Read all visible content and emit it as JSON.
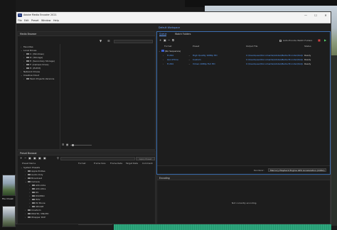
{
  "window": {
    "title": "Adobe Media Encoder 2021",
    "minimize": "—",
    "maximize": "☐",
    "close": "✕"
  },
  "menu": [
    "File",
    "Edit",
    "Preset",
    "Window",
    "Help"
  ],
  "media_browser": {
    "title": "Media Browser",
    "items": [
      {
        "label": "Favorites",
        "indent": 0,
        "arrow": "›"
      },
      {
        "label": "Local Drives",
        "indent": 0,
        "arrow": "⌄"
      },
      {
        "label": "C: (Windows)",
        "indent": 1,
        "arrow": "›"
      },
      {
        "label": "D: (Storage)",
        "indent": 1,
        "arrow": "›"
      },
      {
        "label": "E: (Secondary Storage)",
        "indent": 1,
        "arrow": "›"
      },
      {
        "label": "F: (Camera Drive)",
        "indent": 1,
        "arrow": "›"
      },
      {
        "label": "H: (ExFAT)",
        "indent": 1,
        "arrow": "›"
      },
      {
        "label": "Network Drives",
        "indent": 0,
        "arrow": "›"
      },
      {
        "label": "Creative Cloud",
        "indent": 0,
        "arrow": "⌄"
      },
      {
        "label": "Team Projects Versions",
        "indent": 1,
        "arrow": "›"
      }
    ]
  },
  "preset_browser": {
    "title": "Preset Browser",
    "apply_button": "Apply Preset",
    "columns": [
      "Preset Name",
      "Format",
      "Frame Size",
      "Frame Rate",
      "Target Rate",
      "Comment"
    ],
    "items": [
      {
        "label": "System Presets",
        "indent": 0
      },
      {
        "label": "Apple ProRes",
        "indent": 1
      },
      {
        "label": "Audio Only",
        "indent": 1
      },
      {
        "label": "Broadcast",
        "indent": 1
      },
      {
        "label": "Camera",
        "indent": 1
      },
      {
        "label": "AVC-Intra",
        "indent": 2
      },
      {
        "label": "AVC-Ultra",
        "indent": 2
      },
      {
        "label": "DV",
        "indent": 2
      },
      {
        "label": "DVCPRO",
        "indent": 2
      },
      {
        "label": "HDV",
        "indent": 2
      },
      {
        "label": "P2 Movie",
        "indent": 2
      },
      {
        "label": "XDCAM",
        "indent": 2
      },
      {
        "label": "Cineform",
        "indent": 1
      },
      {
        "label": "DNxHR / DNxHD",
        "indent": 1
      },
      {
        "label": "Wrapper DCP",
        "indent": 1
      }
    ]
  },
  "workspace_tab": "Default Workspace",
  "queue": {
    "tabs": [
      "Queue",
      "Watch Folders"
    ],
    "auto_encode": "Auto-Encode Watch Folders",
    "columns": [
      "Format",
      "Preset",
      "Output File",
      "Status"
    ],
    "group_label": "(No Sequence)",
    "rows": [
      {
        "format": "H.264",
        "preset": "High Quality 1080p HD",
        "output": "C:\\Users\\user\\Documents\\Adobe\\Media Encoder\\Output\\...",
        "status": "Ready"
      },
      {
        "format": "QuickTime",
        "preset": "Custom",
        "output": "C:\\Users\\user\\Documents\\Adobe\\Media Encoder\\Output\\...",
        "status": "Ready"
      },
      {
        "format": "H.264",
        "preset": "Vimeo 1080p Full HD",
        "output": "C:\\Users\\user\\Documents\\Adobe\\Media Encoder\\Output\\...",
        "status": "Ready"
      }
    ],
    "renderer_label": "Renderer:",
    "renderer_value": "Mercury Playback Engine GPU Acceleration (CUDA)"
  },
  "encoding": {
    "title": "Encoding",
    "empty_text": "Not currently encoding."
  },
  "thumbnails": [
    "File Chalet"
  ],
  "timeline": {
    "track_label": "Audio 1"
  },
  "colors": {
    "accent": "#5aa0ff",
    "ready": "#bbbbbb",
    "play": "#56d06b"
  }
}
